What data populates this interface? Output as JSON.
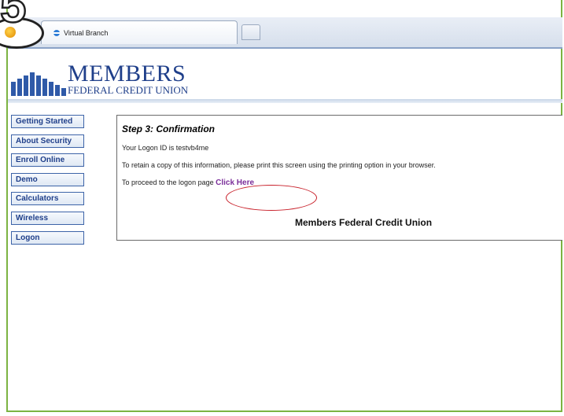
{
  "step_badge": {
    "number": "5"
  },
  "browser": {
    "tab_title": "Virtual Branch"
  },
  "logo": {
    "main": "MEMBERS",
    "sub": "FEDERAL CREDIT UNION"
  },
  "sidebar": {
    "items": [
      {
        "label": "Getting Started"
      },
      {
        "label": "About Security"
      },
      {
        "label": "Enroll Online"
      },
      {
        "label": "Demo"
      },
      {
        "label": "Calculators"
      },
      {
        "label": "Wireless"
      },
      {
        "label": "Logon"
      }
    ]
  },
  "content": {
    "title": "Step 3: Confirmation",
    "logon_id_text": "Your Logon ID is testvb4me",
    "retain_text": "To retain a copy of this information, please print this screen using the printing option in your browser.",
    "proceed_text": "To proceed to the logon page",
    "click_here": "Click Here",
    "cu_name": "Members Federal Credit Union"
  },
  "colors": {
    "frame": "#7cb342",
    "brand_blue": "#1f3f8a",
    "link_purple": "#7b2f9a",
    "highlight_red": "#c8202a"
  }
}
